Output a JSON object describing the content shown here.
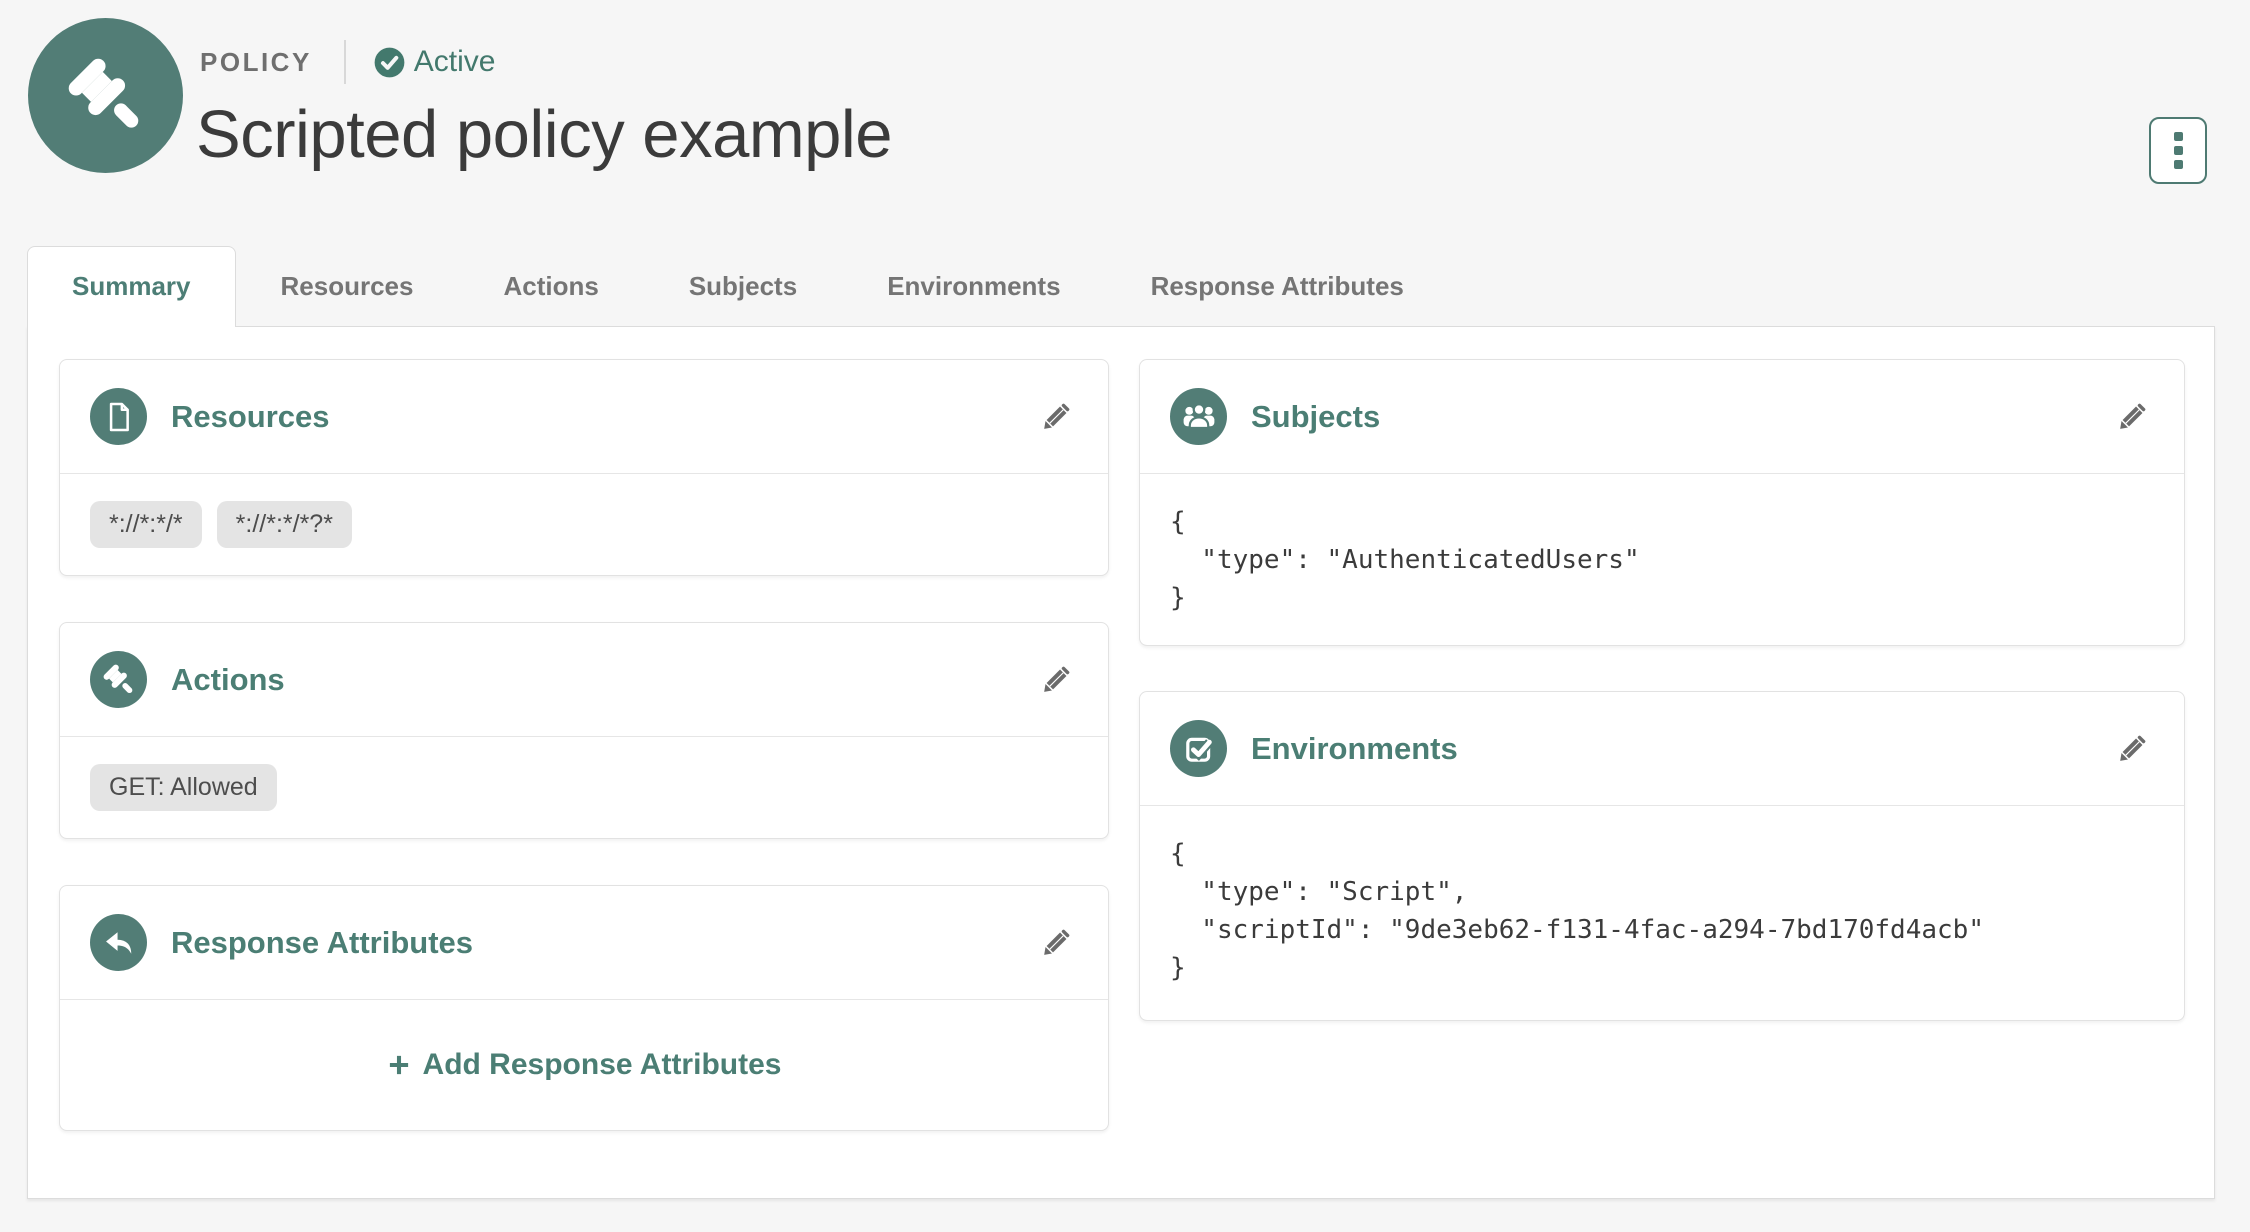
{
  "colors": {
    "teal_circle": "#527d76",
    "teal_text": "#4b7e74",
    "page_bg": "#f6f6f6",
    "inactive_tab_text": "#757575",
    "tag_bg": "#e4e4e4",
    "title_text": "#3b3b3b",
    "pencil_gray": "#6b6b6b"
  },
  "header": {
    "icon": "gavel-icon",
    "entity_label": "POLICY",
    "status": {
      "icon": "check-circle-icon",
      "label": "Active"
    },
    "title": "Scripted policy example",
    "menu_icon": "kebab-menu-icon"
  },
  "tabs": [
    {
      "label": "Summary",
      "active": true
    },
    {
      "label": "Resources",
      "active": false
    },
    {
      "label": "Actions",
      "active": false
    },
    {
      "label": "Subjects",
      "active": false
    },
    {
      "label": "Environments",
      "active": false
    },
    {
      "label": "Response Attributes",
      "active": false
    }
  ],
  "cards": {
    "resources": {
      "title": "Resources",
      "icon": "file-icon",
      "edit_icon": "pencil-icon",
      "tags": [
        "*://*:*/*",
        "*://*:*/*?*"
      ]
    },
    "actions": {
      "title": "Actions",
      "icon": "gavel-icon",
      "edit_icon": "pencil-icon",
      "tags": [
        "GET: Allowed"
      ]
    },
    "response_attributes": {
      "title": "Response Attributes",
      "icon": "reply-arrow-icon",
      "edit_icon": "pencil-icon",
      "add_icon": "plus-icon",
      "add_button": "Add Response Attributes"
    },
    "subjects": {
      "title": "Subjects",
      "icon": "users-icon",
      "edit_icon": "pencil-icon",
      "code": "{\n  \"type\": \"AuthenticatedUsers\"\n}"
    },
    "environments": {
      "title": "Environments",
      "icon": "check-square-icon",
      "edit_icon": "pencil-icon",
      "code": "{\n  \"type\": \"Script\",\n  \"scriptId\": \"9de3eb62-f131-4fac-a294-7bd170fd4acb\"\n}"
    }
  }
}
